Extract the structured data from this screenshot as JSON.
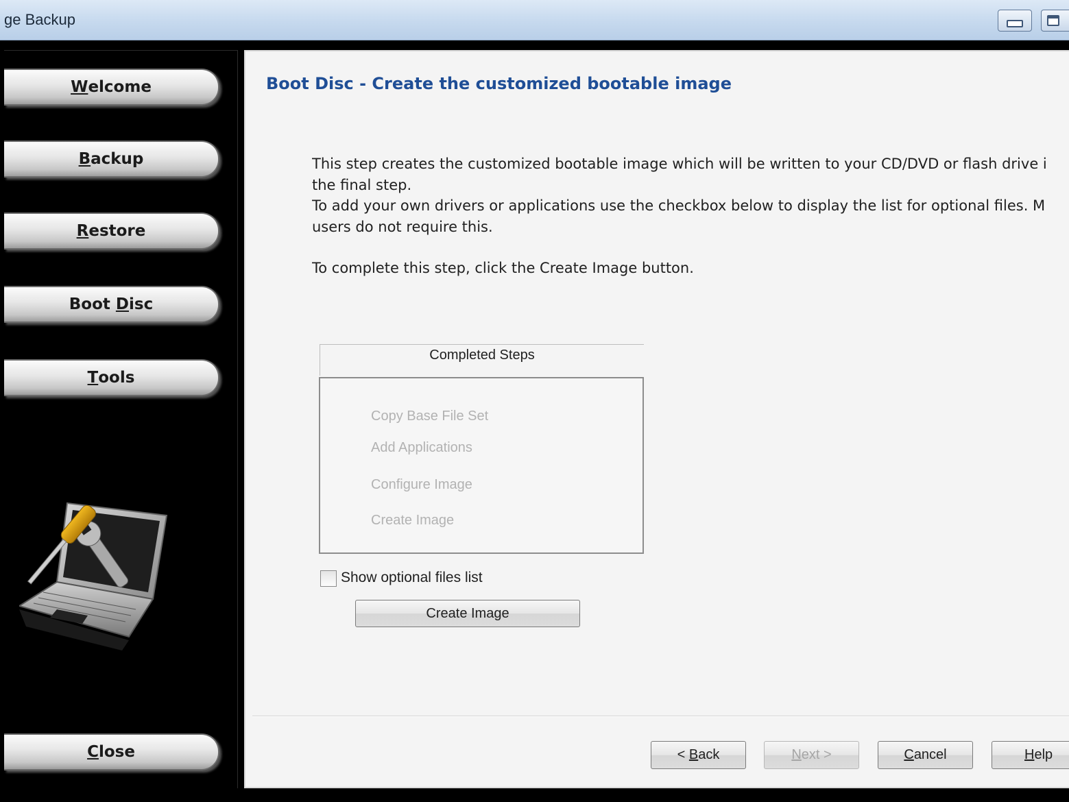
{
  "window": {
    "title": "ge Backup"
  },
  "sidebar": {
    "items": [
      {
        "id": "welcome",
        "pre": "",
        "key": "W",
        "post": "elcome"
      },
      {
        "id": "backup",
        "pre": "",
        "key": "B",
        "post": "ackup"
      },
      {
        "id": "restore",
        "pre": "",
        "key": "R",
        "post": "estore"
      },
      {
        "id": "boot_disc",
        "pre": "Boot ",
        "key": "D",
        "post": "isc"
      },
      {
        "id": "tools",
        "pre": "",
        "key": "T",
        "post": "ools"
      }
    ],
    "close": {
      "pre": "",
      "key": "C",
      "post": "lose"
    },
    "art_icon": "laptop-tools-icon"
  },
  "main": {
    "heading": "Boot Disc - Create the customized bootable image",
    "description": {
      "line1": "This step creates the customized bootable image which will be written to your CD/DVD or flash drive i",
      "line2": "the final step.",
      "line3": "To add your own drivers or applications use the checkbox below to display the list for optional files. M",
      "line4": "users do not require this.",
      "line5": "To complete this step, click the Create Image button."
    },
    "completed_steps": {
      "title": "Completed Steps",
      "steps": [
        "Copy Base File Set",
        "Add Applications",
        "Configure Image",
        "Create Image"
      ]
    },
    "show_optional": {
      "label": "Show optional files list",
      "checked": false
    },
    "create_image_label": "Create Image"
  },
  "footer": {
    "back": {
      "pre": "< ",
      "key": "B",
      "post": "ack"
    },
    "next": {
      "pre": "",
      "key": "N",
      "post": "ext >",
      "enabled": false
    },
    "cancel": {
      "pre": "",
      "key": "C",
      "post": "ancel"
    },
    "help": {
      "pre": "",
      "key": "H",
      "post": "elp"
    }
  },
  "colors": {
    "heading": "#1f4e96",
    "sidebar_bg": "#000000",
    "panel_bg": "#f4f4f4",
    "disabled_text": "#b2b2b2"
  }
}
